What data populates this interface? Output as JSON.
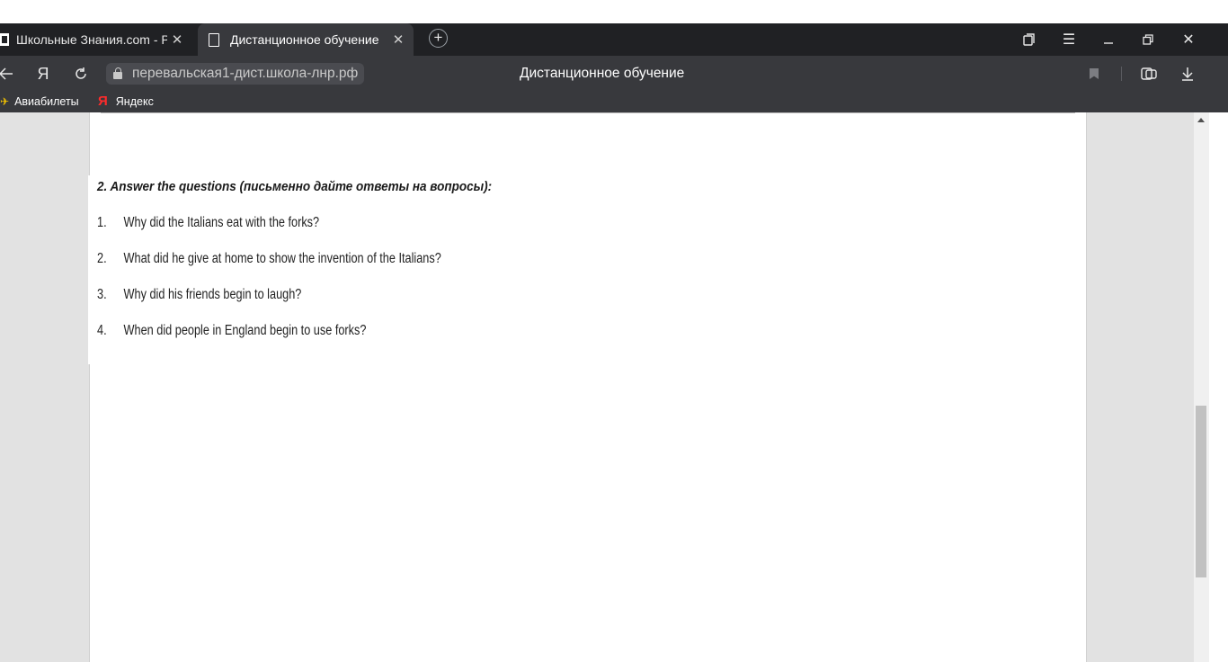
{
  "tabs": [
    {
      "title": "Школьные Знания.com - Ре",
      "active": false
    },
    {
      "title": "Дистанционное обучение",
      "active": true
    }
  ],
  "toolbar": {
    "back_icon": "back-arrow-icon",
    "yandex_icon": "yandex-logo-icon",
    "yandex_letter": "Я",
    "reload_icon": "reload-icon",
    "url": "перевальская1-дист.школа-лнр.рф",
    "page_title": "Дистанционное обучение"
  },
  "window_controls": [
    "tablist-icon",
    "menu-icon",
    "minimize-icon",
    "restore-icon",
    "close-icon"
  ],
  "bookmarks": [
    {
      "label": "Авиабилеты",
      "icon": "plane-icon"
    },
    {
      "label": "Яндекс",
      "icon": "yandex-icon"
    }
  ],
  "content": {
    "heading": "2. Answer the questions (письменно дайте ответы на вопросы):",
    "questions": [
      {
        "num": "1.",
        "text": "Why did the Italians eat with the forks?"
      },
      {
        "num": "2.",
        "text": "What did he give at home to show the invention of the Italians?"
      },
      {
        "num": "3.",
        "text": "Why did his friends begin to laugh?"
      },
      {
        "num": "4.",
        "text": "When did people in England begin to use forks?"
      }
    ]
  },
  "colors": {
    "tab_strip": "#202124",
    "toolbar": "#38393d",
    "page_bg": "#e2e2e2",
    "document": "#ffffff"
  }
}
